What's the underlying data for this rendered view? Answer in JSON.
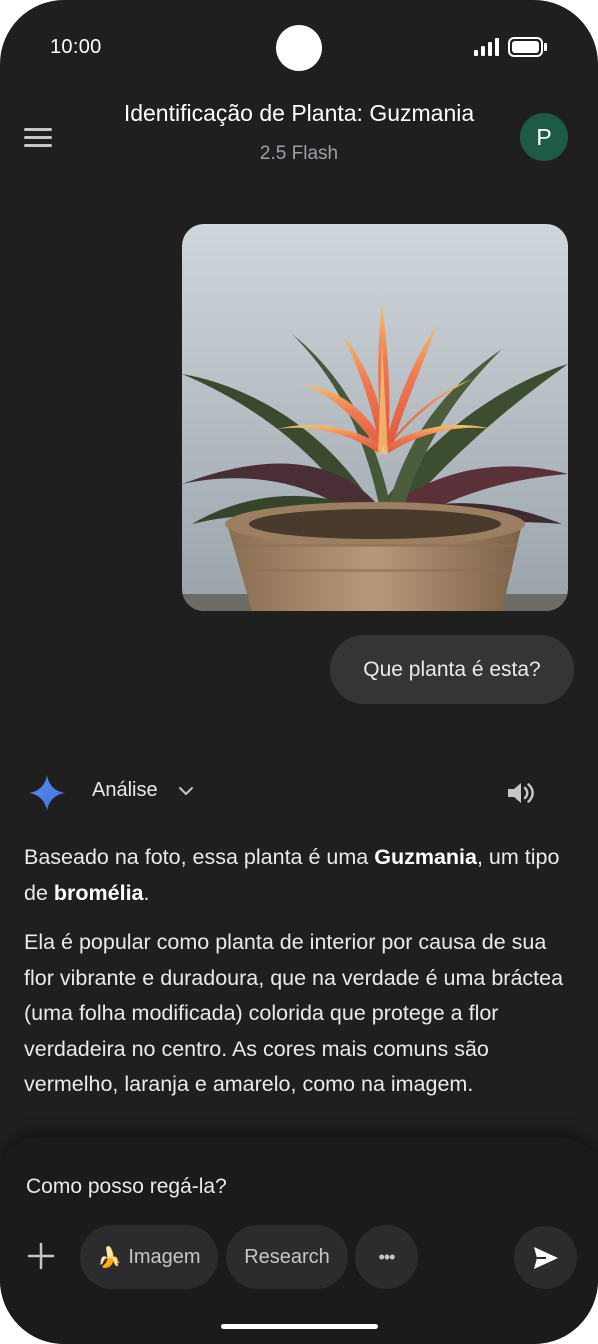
{
  "status": {
    "time": "10:00",
    "icons": [
      "signal-icon",
      "battery-icon"
    ]
  },
  "header": {
    "title": "Identificação de Planta: Guzmania",
    "model": "2.5 Flash",
    "avatar_letter": "P"
  },
  "user_message": {
    "text": "Que planta é esta?",
    "attachment": "plant-photo"
  },
  "response": {
    "mode_label": "Análise",
    "p1_a": "Baseado na foto, essa planta é uma ",
    "p1_b": "Guzmania",
    "p1_c": ", um tipo de ",
    "p1_d": "bromélia",
    "p1_e": ".",
    "p2": "Ela é popular como planta de interior por causa de sua flor vibrante e duradoura, que na verdade é uma bráctea (uma folha modificada) colorida que protege a flor verdadeira no centro. As cores mais comuns são vermelho, laranja e amarelo, como na imagem."
  },
  "composer": {
    "input_value": "Como posso regá-la?",
    "chips": {
      "image_emoji": "🍌",
      "image_label": "Imagem",
      "research_label": "Research",
      "more_label": "•••"
    }
  },
  "colors": {
    "background": "#1f1f20",
    "bubble": "#333537",
    "avatar": "#1e5b46",
    "accent_blue": "#4285f4"
  }
}
